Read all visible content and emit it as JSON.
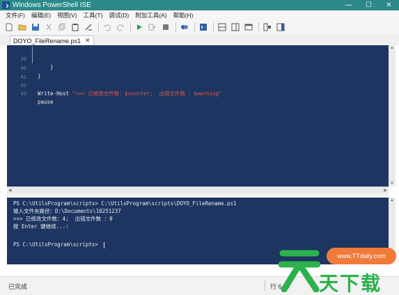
{
  "window": {
    "title": "Windows PowerShell ISE",
    "controls": [
      "—",
      "☐",
      "✕"
    ]
  },
  "menu": [
    "文件(F)",
    "编辑(E)",
    "视图(V)",
    "工具(T)",
    "调试(D)",
    "附加工具(A)",
    "帮助(H)"
  ],
  "toolbar": {
    "icons": [
      "new-file-icon",
      "open-folder-icon",
      "save-icon",
      "cut-icon",
      "copy-icon",
      "paste-icon",
      "clear-icon",
      "undo-icon",
      "redo-icon",
      "run-icon",
      "run-selection-icon",
      "stop-icon",
      "remote-icon",
      "console-icon",
      "layout-top-icon",
      "layout-right-icon",
      "layout-max-icon",
      "show-commands-icon",
      "addon-icon"
    ],
    "accent_run": "#2ea043"
  },
  "tab": {
    "name": "DOYO_FileRename.ps1",
    "close": "✕"
  },
  "editor": {
    "lines": [
      {
        "num": "39",
        "code": "    }"
      },
      {
        "num": "40",
        "code": "}"
      },
      {
        "num": "41",
        "code": ""
      },
      {
        "num": "42",
        "cmd": "Write-Host ",
        "str": "\">>> 已修改文件数：$counter;  出错文件数 ：$warning\""
      },
      {
        "num": "43",
        "code": "pause"
      }
    ],
    "background": "#1d3560"
  },
  "console": {
    "lines": [
      "PS C:\\UtilsProgram\\scripts> C:\\UtilsProgram\\scripts\\DOYO_FileRename.ps1",
      "输入文件夹路径：D:\\Documents\\10251237",
      ">>> 已修改文件数：4;  出错文件数 ：0",
      "按 Enter 键继续...:",
      "",
      "PS C:\\UtilsProgram\\scripts> "
    ]
  },
  "status": {
    "text": "已完成",
    "position": "行 6"
  },
  "watermark": {
    "url": "www.TTdaily.com",
    "brand": "天下载"
  }
}
